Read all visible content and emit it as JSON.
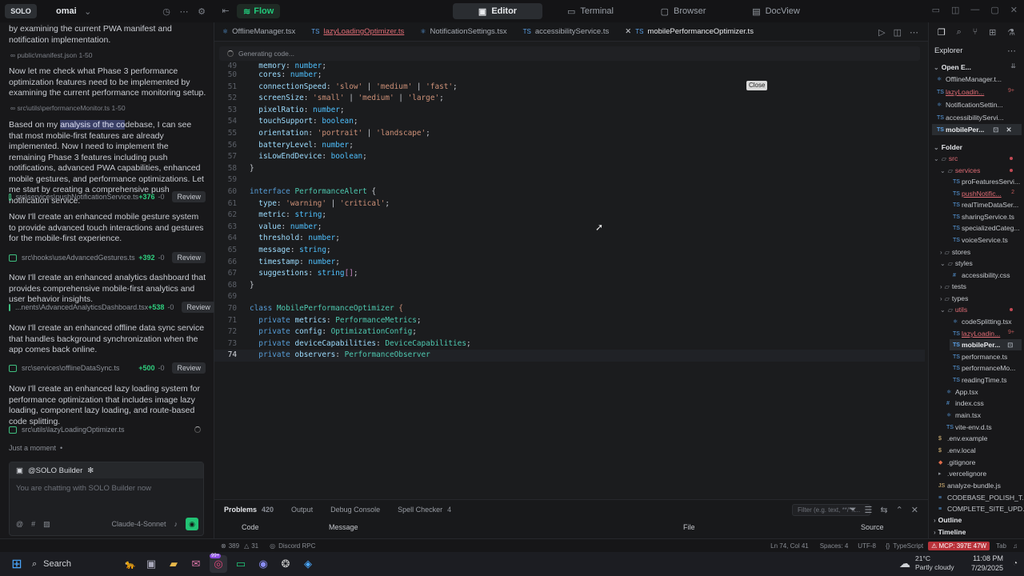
{
  "topbar": {
    "logo": "SOLO",
    "workspace": "omai",
    "flow_label": "Flow",
    "modes": [
      "Editor",
      "Terminal",
      "Browser",
      "DocView"
    ]
  },
  "chat": {
    "intro_text": "by examining the current PWA manifest and notification implementation.",
    "ref_manifest": "public\\manifest.json  1-50",
    "msg_phase3": "Now let me check what Phase 3 performance optimization features need to be implemented by examining the current performance monitoring setup.",
    "ref_perfmon": "src\\utils\\performanceMonitor.ts  1-50",
    "msg_analysis_pre": "Based on my ",
    "msg_analysis_hl": "analysis of the co",
    "msg_analysis_post": "debase, I can see that most mobile-first features are already implemented. Now I need to implement the remaining Phase 3 features including push notifications, advanced PWA capabilities, enhanced mobile gestures, and performance optimizations. Let me start by creating a comprehensive push notification service.",
    "file1": {
      "path": "src\\services\\pushNotificationService.ts",
      "add": "+376",
      "del": "-0",
      "review": "Review"
    },
    "msg_gesture": "Now I'll create an enhanced mobile gesture system to provide advanced touch interactions and gestures for the mobile-first experience.",
    "file2": {
      "path": "src\\hooks\\useAdvancedGestures.ts",
      "add": "+392",
      "del": "-0",
      "review": "Review"
    },
    "msg_analytics": "Now I'll create an enhanced analytics dashboard that provides comprehensive mobile-first analytics and user behavior insights.",
    "file3": {
      "path": "...nents\\AdvancedAnalyticsDashboard.tsx",
      "add": "+538",
      "del": "-0",
      "review": "Review"
    },
    "msg_sync": "Now I'll create an enhanced offline data sync service that handles background synchronization when the app comes back online.",
    "file4": {
      "path": "src\\services\\offlineDataSync.ts",
      "add": "+500",
      "del": "-0",
      "review": "Review"
    },
    "msg_lazy": "Now I'll create an enhanced lazy loading system for performance optimization that includes image lazy loading, component lazy loading, and route-based code splitting.",
    "file5": {
      "path": "src\\utils\\lazyLoadingOptimizer.ts"
    },
    "status": "Just a moment",
    "composer": {
      "agent": "@SOLO Builder",
      "placeholder": "You are chatting with SOLO Builder now",
      "model": "Claude-4-Sonnet"
    }
  },
  "editor": {
    "tabs": [
      {
        "label": "OfflineManager.tsx",
        "prefix": ""
      },
      {
        "label": "lazyLoadingOptimizer.ts",
        "prefix": "TS"
      },
      {
        "label": "NotificationSettings.tsx",
        "prefix": ""
      },
      {
        "label": "accessibilityService.ts",
        "prefix": "TS"
      },
      {
        "label": "mobilePerformanceOptimizer.ts",
        "prefix": "TS"
      }
    ],
    "generating": "Generating code...",
    "close_tooltip": "Close",
    "lines": {
      "n49": "49",
      "n50": "50",
      "n51": "51",
      "n52": "52",
      "n53": "53",
      "n54": "54",
      "n55": "55",
      "n56": "56",
      "n57": "57",
      "n58": "58",
      "n59": "59",
      "n60": "60",
      "n61": "61",
      "n62": "62",
      "n63": "63",
      "n64": "64",
      "n65": "65",
      "n66": "66",
      "n67": "67",
      "n68": "68",
      "n69": "69",
      "n70": "70",
      "n71": "71",
      "n72": "72",
      "n73": "73",
      "n74": "74"
    }
  },
  "panel": {
    "problems": "Problems",
    "problems_count": "420",
    "output": "Output",
    "debug": "Debug Console",
    "spell": "Spell Checker",
    "spell_count": "4",
    "filter_placeholder": "Filter (e.g. text, **/*.t...",
    "col_code": "Code",
    "col_message": "Message",
    "col_file": "File",
    "col_source": "Source"
  },
  "explorer": {
    "title": "Explorer",
    "open_editors": "Open E...",
    "open_files": [
      "OfflineManager.t...",
      "lazyLoadin...",
      "NotificationSettin...",
      "accessibilityServi...",
      "mobilePer..."
    ],
    "folder": "Folder",
    "tree": {
      "src": "src",
      "services": "services",
      "proFeatures": "proFeaturesServi...",
      "pushNotif": "pushNotific...",
      "realTime": "realTimeDataSer...",
      "sharing": "sharingService.ts",
      "specialized": "specializedCateg...",
      "voice": "voiceService.ts",
      "stores": "stores",
      "styles": "styles",
      "a11ycss": "accessibility.css",
      "tests": "tests",
      "types": "types",
      "utils": "utils",
      "codeSplit": "codeSplitting.tsx",
      "lazyLoad": "lazyLoadin...",
      "mobilePer": "mobilePer...",
      "perf": "performance.ts",
      "perfMon": "performanceMo...",
      "reading": "readingTime.ts",
      "app": "App.tsx",
      "indexcss": "index.css",
      "main": "main.tsx",
      "viteenv": "vite-env.d.ts",
      "envex": ".env.example",
      "envlocal": ".env.local",
      "gitignore": ".gitignore",
      "vercelignore": ".vercelignore",
      "analyze": "analyze-bundle.js",
      "codebase": "CODEBASE_POLISH_T...",
      "complete": "COMPLETE_SITE_UPD..."
    },
    "outline": "Outline",
    "timeline": "Timeline",
    "badges": {
      "lazy_open": "9+",
      "push": "2",
      "lazy_utils": "9+"
    }
  },
  "statusbar": {
    "errors": "389",
    "warnings": "31",
    "discord": "Discord RPC",
    "position": "Ln 74, Col 41",
    "spaces": "Spaces: 4",
    "encoding": "UTF-8",
    "lang": "TypeScript",
    "mcp": "MCP: 397E 47W",
    "tab": "Tab"
  },
  "taskbar": {
    "search": "Search",
    "temp": "21°C",
    "weather": "Partly cloudy",
    "time": "11:08 PM",
    "date": "7/29/2025",
    "notif": "99+"
  }
}
